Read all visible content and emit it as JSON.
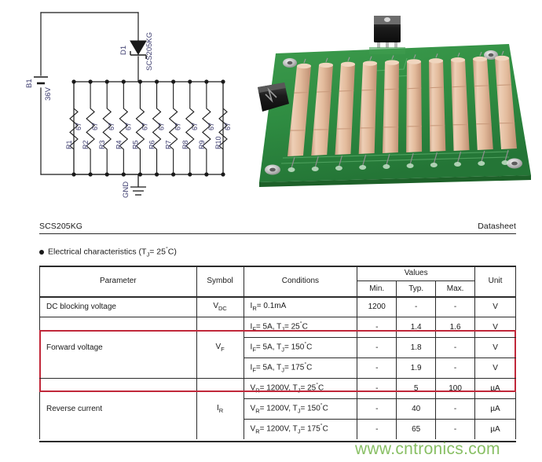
{
  "schematic": {
    "battery": {
      "ref": "B1",
      "value": "36V"
    },
    "diode": {
      "ref": "D1",
      "part": "SCS205KG"
    },
    "ground": {
      "label": "GND"
    },
    "resistors": [
      {
        "ref": "R1",
        "value": "67"
      },
      {
        "ref": "R2",
        "value": "67"
      },
      {
        "ref": "R3",
        "value": "67"
      },
      {
        "ref": "R4",
        "value": "67"
      },
      {
        "ref": "R5",
        "value": "67"
      },
      {
        "ref": "R6",
        "value": "67"
      },
      {
        "ref": "R7",
        "value": "67"
      },
      {
        "ref": "R8",
        "value": "67"
      },
      {
        "ref": "R9",
        "value": "67"
      },
      {
        "ref": "R10",
        "value": "67"
      }
    ]
  },
  "photo": {
    "description": "pcb-photo",
    "board_color": "#2f8b42",
    "resistor_color": "#e0b89c",
    "component_count": 10
  },
  "document": {
    "header_left": "SCS205KG",
    "header_right": "Datasheet",
    "section_title_prefix": "Electrical characteristics (T",
    "section_title_sub": "J",
    "section_title_suffix": "= 25",
    "section_title_unit": "C"
  },
  "table": {
    "headers": {
      "parameter": "Parameter",
      "symbol": "Symbol",
      "conditions": "Conditions",
      "values": "Values",
      "unit": "Unit",
      "min": "Min.",
      "typ": "Typ.",
      "max": "Max."
    },
    "groups": [
      {
        "parameter": "DC blocking voltage",
        "symbol_main": "V",
        "symbol_sub": "DC",
        "rows": [
          {
            "cond_main": "I",
            "cond_sub": "R",
            "cond_rest": "= 0.1mA",
            "cond_sub2": "",
            "cond_rest2": "",
            "cond_deg": "",
            "min": "1200",
            "typ": "-",
            "max": "-",
            "unit": "V"
          }
        ]
      },
      {
        "parameter": "Forward voltage",
        "symbol_main": "V",
        "symbol_sub": "F",
        "highlighted": true,
        "rows": [
          {
            "cond_main": "I",
            "cond_sub": "F",
            "cond_rest": "= 5A, T",
            "cond_sub2": "J",
            "cond_rest2": "= 25",
            "cond_deg": "C",
            "min": "-",
            "typ": "1.4",
            "max": "1.6",
            "unit": "V"
          },
          {
            "cond_main": "I",
            "cond_sub": "F",
            "cond_rest": "= 5A, T",
            "cond_sub2": "J",
            "cond_rest2": "= 150",
            "cond_deg": "C",
            "min": "-",
            "typ": "1.8",
            "max": "-",
            "unit": "V"
          },
          {
            "cond_main": "I",
            "cond_sub": "F",
            "cond_rest": "= 5A, T",
            "cond_sub2": "J",
            "cond_rest2": "= 175",
            "cond_deg": "C",
            "min": "-",
            "typ": "1.9",
            "max": "-",
            "unit": "V"
          }
        ]
      },
      {
        "parameter": "Reverse current",
        "symbol_main": "I",
        "symbol_sub": "R",
        "rows": [
          {
            "cond_main": "V",
            "cond_sub": "R",
            "cond_rest": "= 1200V, T",
            "cond_sub2": "J",
            "cond_rest2": "= 25",
            "cond_deg": "C",
            "min": "-",
            "typ": "5",
            "max": "100",
            "unit": "µA"
          },
          {
            "cond_main": "V",
            "cond_sub": "R",
            "cond_rest": "= 1200V, T",
            "cond_sub2": "J",
            "cond_rest2": "= 150",
            "cond_deg": "C",
            "min": "-",
            "typ": "40",
            "max": "-",
            "unit": "µA"
          },
          {
            "cond_main": "V",
            "cond_sub": "R",
            "cond_rest": "= 1200V, T",
            "cond_sub2": "J",
            "cond_rest2": "= 175",
            "cond_deg": "C",
            "min": "-",
            "typ": "65",
            "max": "-",
            "unit": "µA"
          }
        ]
      }
    ]
  },
  "watermark": {
    "text": "www.cntronics.com",
    "color": "#74b54a"
  },
  "colors": {
    "highlight": "#c1283a",
    "schematic_label": "#3b3b6e",
    "rule": "#2b2b2b"
  }
}
